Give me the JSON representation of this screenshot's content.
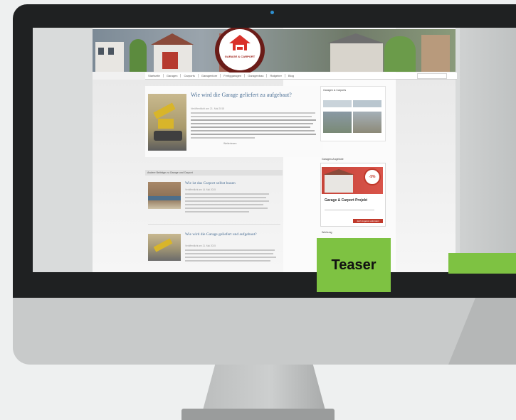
{
  "monitor": {
    "camera_color": "#2e8fd0"
  },
  "site": {
    "logo_text": "GARAGE & CARPORT",
    "nav": [
      "Startseite",
      "Garagen",
      "Carports",
      "Garagentore",
      "Fertiggaragen",
      "Garagenbau",
      "Ratgeber",
      "Blog"
    ],
    "article": {
      "title": "Wie wird die Garage geliefert zu aufgebaut?",
      "meta": "Veröffentlicht am 21. Mai 2015",
      "more": "Weiterlesen"
    },
    "related_heading": "Andere Beiträge zu Garage und Carport",
    "related": [
      {
        "title": "Wie ist das Carport selbst bauen",
        "meta": "Veröffentlicht am 14. Mai 2015"
      },
      {
        "title": "Wie wird die Garage geliefert und aufgebaut?",
        "meta": "Veröffentlicht am 21. Mai 2015"
      }
    ],
    "sidebar": {
      "widget1_title": "Garagen & Carports",
      "widget2_title": "Garagen-Angebote",
      "ad_badge": "-5%",
      "ad_headline": "Garage & Carport Projekt",
      "ad_button": "Jetzt Angebot anfordern",
      "widget3_title": "Werbung"
    }
  },
  "teaser": {
    "label": "Teaser",
    "color": "#7ec242"
  }
}
